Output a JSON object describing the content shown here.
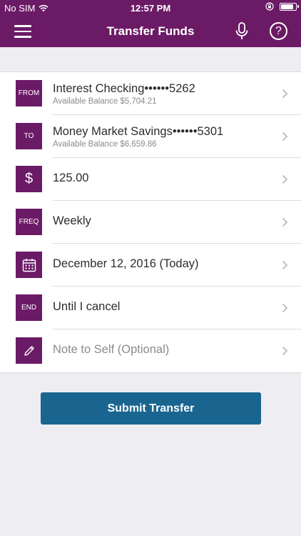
{
  "status_bar": {
    "carrier": "No SIM",
    "time": "12:57 PM"
  },
  "nav": {
    "title": "Transfer Funds"
  },
  "form": {
    "from": {
      "tag": "FROM",
      "account": "Interest Checking••••••5262",
      "balance": "Available Balance $5,704.21"
    },
    "to": {
      "tag": "TO",
      "account": "Money Market Savings••••••5301",
      "balance": "Available Balance $6,659.86"
    },
    "amount": {
      "tag": "$",
      "value": "125.00"
    },
    "frequency": {
      "tag": "FREQ",
      "value": "Weekly"
    },
    "date": {
      "value": "December 12, 2016 (Today)"
    },
    "end": {
      "tag": "END",
      "value": "Until I cancel"
    },
    "note": {
      "placeholder": "Note to Self (Optional)"
    }
  },
  "submit_label": "Submit Transfer",
  "colors": {
    "brand": "#6b1a66",
    "button": "#1a6590",
    "background": "#eeedf2"
  },
  "icons": [
    "wifi-icon",
    "menu-icon",
    "microphone-icon",
    "help-icon",
    "orientation-lock-icon",
    "battery-icon",
    "calendar-icon",
    "pencil-icon",
    "chevron-right-icon"
  ]
}
